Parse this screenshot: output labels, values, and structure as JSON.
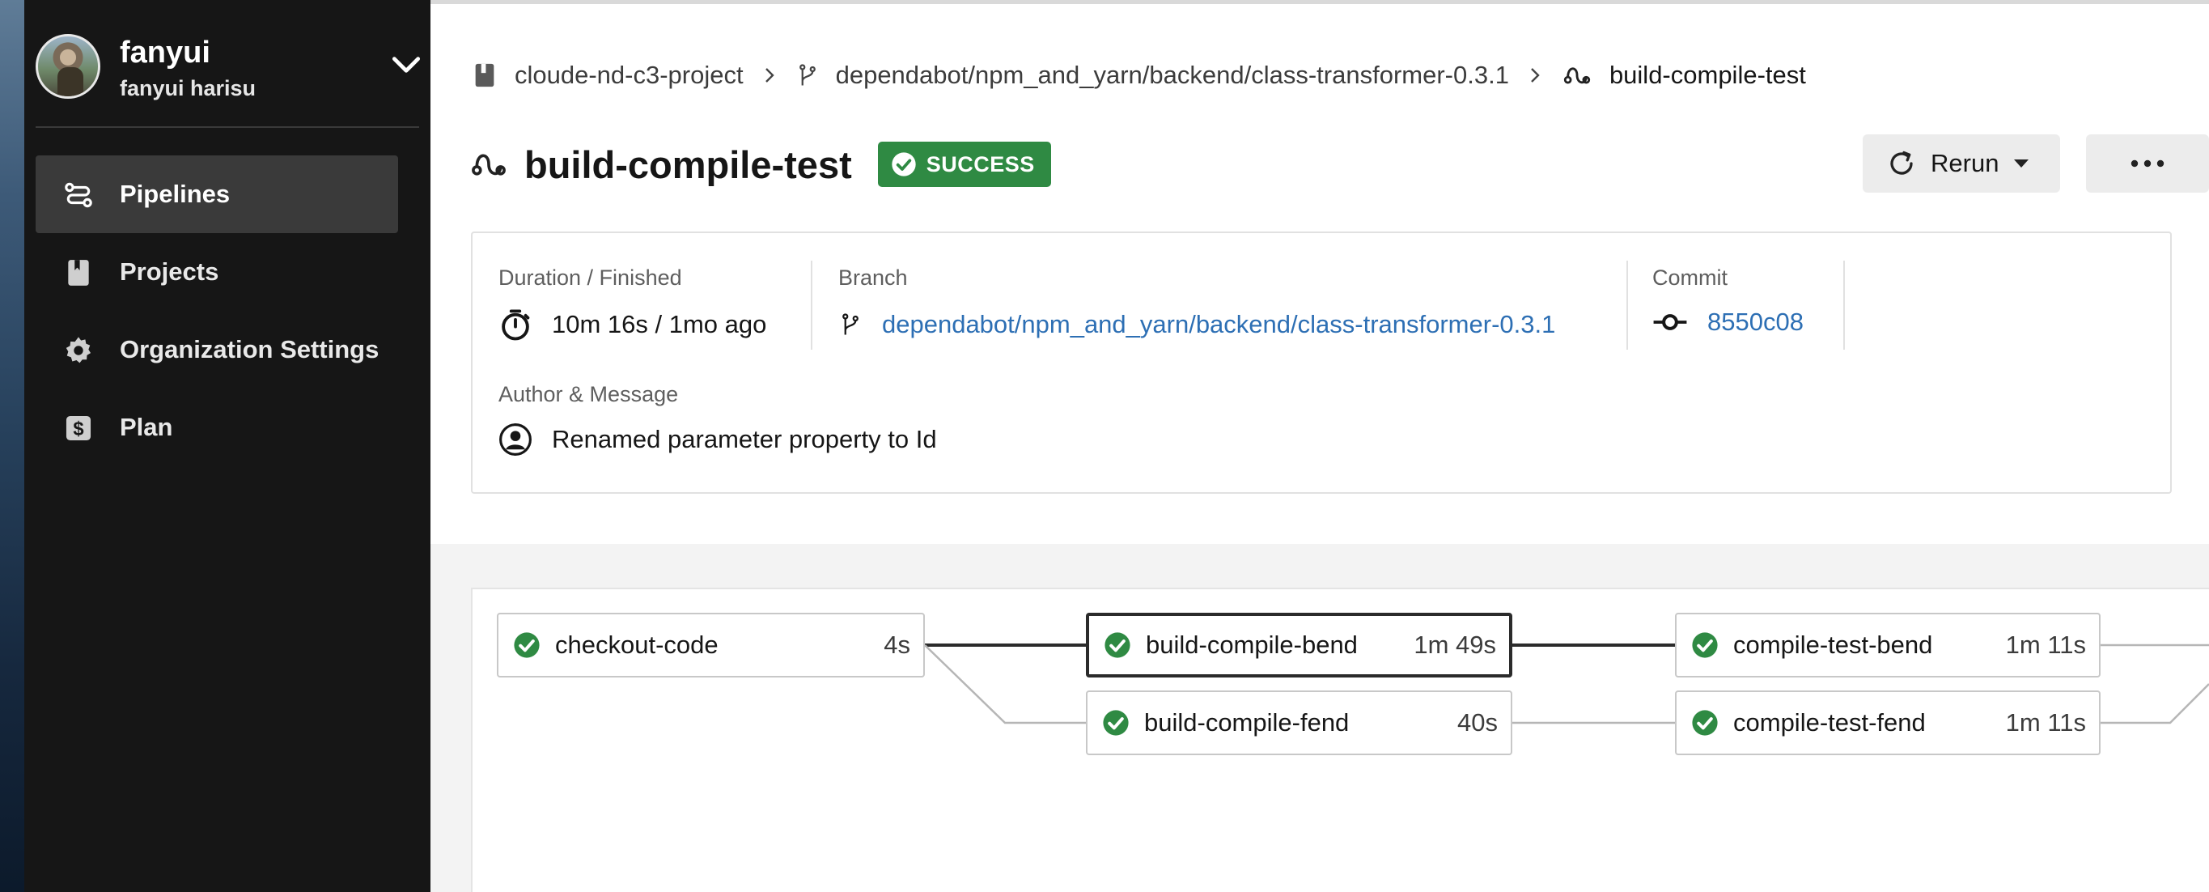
{
  "user": {
    "username": "fanyui",
    "full_name": "fanyui harisu"
  },
  "sidebar": {
    "items": [
      {
        "label": "Pipelines",
        "icon": "pipelines-icon",
        "active": true
      },
      {
        "label": "Projects",
        "icon": "book-icon",
        "active": false
      },
      {
        "label": "Organization Settings",
        "icon": "gear-icon",
        "active": false
      },
      {
        "label": "Plan",
        "icon": "dollar-icon",
        "active": false
      }
    ]
  },
  "breadcrumb": {
    "project": "cloude-nd-c3-project",
    "branch": "dependabot/npm_and_yarn/backend/class-transformer-0.3.1",
    "workflow": "build-compile-test"
  },
  "header": {
    "title": "build-compile-test",
    "status": "SUCCESS",
    "rerun_label": "Rerun"
  },
  "details": {
    "duration_label": "Duration / Finished",
    "duration_value": "10m 16s / 1mo ago",
    "branch_label": "Branch",
    "branch_value": "dependabot/npm_and_yarn/backend/class-transformer-0.3.1",
    "commit_label": "Commit",
    "commit_value": "8550c08",
    "author_label": "Author & Message",
    "message": "Renamed parameter property to Id"
  },
  "jobs": [
    {
      "name": "checkout-code",
      "duration": "4s"
    },
    {
      "name": "build-compile-bend",
      "duration": "1m 49s"
    },
    {
      "name": "build-compile-fend",
      "duration": "40s"
    },
    {
      "name": "compile-test-bend",
      "duration": "1m 11s"
    },
    {
      "name": "compile-test-fend",
      "duration": "1m 11s"
    }
  ],
  "colors": {
    "sidebar_bg": "#161616",
    "success": "#2f8a43",
    "link": "#2d6fb4"
  }
}
